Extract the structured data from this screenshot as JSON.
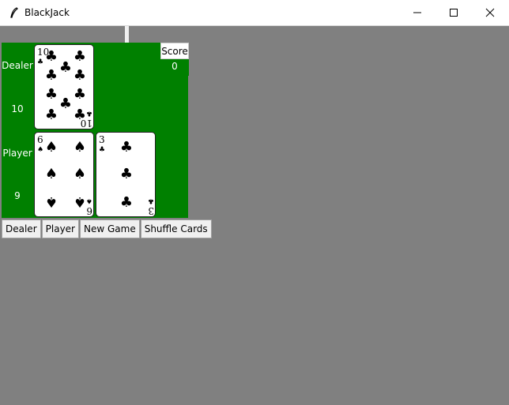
{
  "window": {
    "title": "BlackJack",
    "icon": "feather-icon",
    "controls": [
      "minimize-icon",
      "maximize-icon",
      "close-icon"
    ]
  },
  "table": {
    "background": "#008000",
    "dealer_label": "Dealer",
    "dealer_score": "10",
    "player_label": "Player",
    "player_score": "9",
    "dealer_cards": [
      {
        "rank": "10",
        "suit": "clubs"
      }
    ],
    "player_cards": [
      {
        "rank": "6",
        "suit": "spades"
      },
      {
        "rank": "3",
        "suit": "clubs"
      }
    ]
  },
  "score": {
    "title": "Score",
    "value": "0"
  },
  "buttons": {
    "dealer": "Dealer",
    "player": "Player",
    "new_game": "New Game",
    "shuffle": "Shuffle Cards"
  },
  "colors": {
    "felt": "#008000",
    "window_bg": "#808080"
  }
}
